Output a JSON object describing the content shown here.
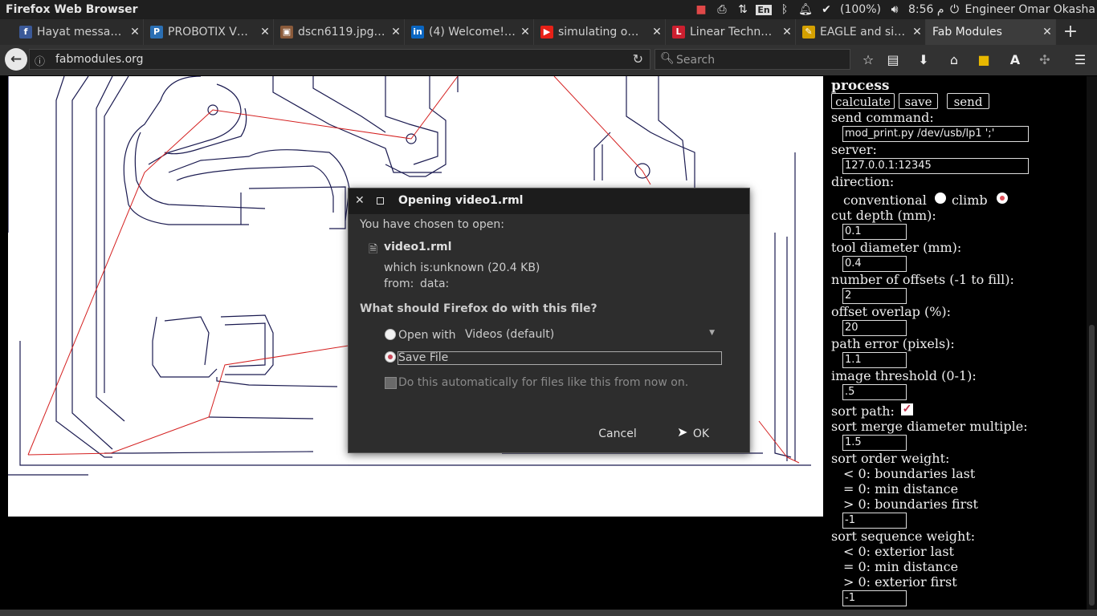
{
  "system": {
    "app_title": "Firefox Web Browser",
    "battery": "(100%)",
    "clock": "8:56 م",
    "user": "Engineer Omar Okasha",
    "keyboard_layout": "En"
  },
  "tabs": [
    {
      "label": "Hayat messa…",
      "icon": "facebook-icon",
      "color": "#3b5998"
    },
    {
      "label": "PROBOTIX V…",
      "icon": "probotix-icon",
      "color": "#2b6fb3"
    },
    {
      "label": "dscn6119.jpg…",
      "icon": "image-icon",
      "color": "#8a5a3a"
    },
    {
      "label": "(4) Welcome!…",
      "icon": "linkedin-icon",
      "color": "#0a66c2"
    },
    {
      "label": "simulating o…",
      "icon": "youtube-icon",
      "color": "#e62117"
    },
    {
      "label": "Linear Techn…",
      "icon": "linear-tech-icon",
      "color": "#cc1f2f"
    },
    {
      "label": "EAGLE and si…",
      "icon": "eagle-icon",
      "color": "#d4a000"
    },
    {
      "label": "Fab Modules",
      "icon": "",
      "color": "#3c3c3c"
    }
  ],
  "nav": {
    "url": "fabmodules.org",
    "search_placeholder": "Search"
  },
  "panel": {
    "heading": "process",
    "buttons": [
      "calculate",
      "save",
      "send"
    ],
    "send_command_label": "send command:",
    "send_command_value": "mod_print.py /dev/usb/lp1 ';'",
    "server_label": "server:",
    "server_value": "127.0.0.1:12345",
    "direction_label": "direction:",
    "direction_conventional": "conventional",
    "direction_climb": "climb",
    "direction_selected": "climb",
    "cut_depth_label": "cut depth (mm):",
    "cut_depth_value": "0.1",
    "tool_diameter_label": "tool diameter (mm):",
    "tool_diameter_value": "0.4",
    "offsets_label": "number of offsets (-1 to fill):",
    "offsets_value": "2",
    "overlap_label": "offset overlap (%):",
    "overlap_value": "20",
    "path_error_label": "path error (pixels):",
    "path_error_value": "1.1",
    "threshold_label": "image threshold (0-1):",
    "threshold_value": ".5",
    "sort_path_label": "sort path:",
    "sort_path_checked": true,
    "merge_label": "sort merge diameter multiple:",
    "merge_value": "1.5",
    "order_label": "sort order weight:",
    "order_lines": [
      "< 0: boundaries last",
      "= 0: min distance",
      "> 0: boundaries first"
    ],
    "order_value": "-1",
    "sequence_label": "sort sequence weight:",
    "sequence_lines": [
      "< 0: exterior last",
      "= 0: min distance",
      "> 0: exterior first"
    ],
    "sequence_value": "-1"
  },
  "dialog": {
    "title": "Opening video1.rml",
    "chosen_text": "You have chosen to open:",
    "filename": "video1.rml",
    "which_is_label": "which is:",
    "which_is_value": "unknown (20.4 KB)",
    "from_label": "from:",
    "from_value": "data:",
    "question": "What should Firefox do with this file?",
    "open_with_label": "Open with",
    "open_with_app": "Videos (default)",
    "save_label": "Save File",
    "selected_option": "save",
    "auto_label": "Do this automatically for files like this from now on.",
    "cancel_label": "Cancel",
    "ok_label": "OK"
  }
}
